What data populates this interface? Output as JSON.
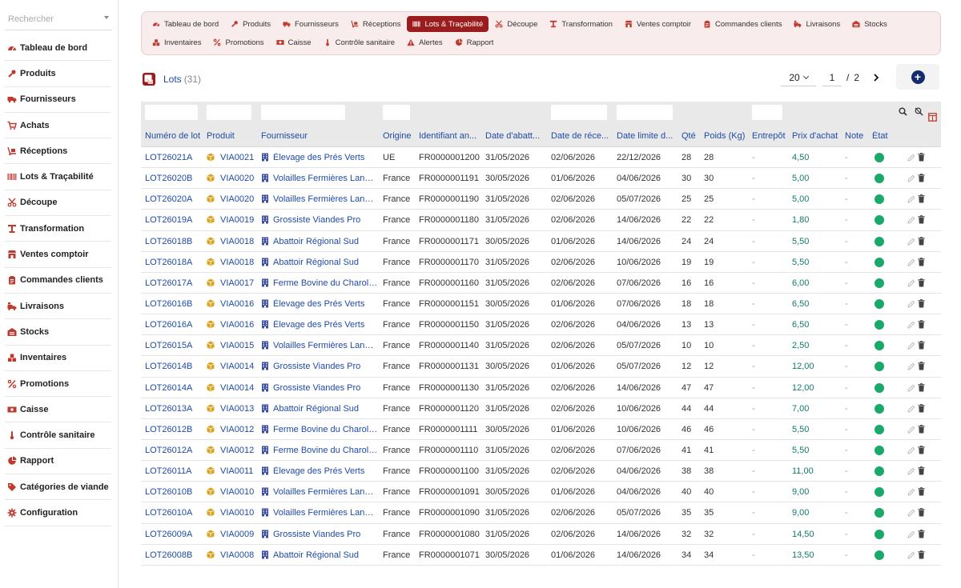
{
  "sidebar": {
    "search_placeholder": "Rechercher",
    "items": [
      {
        "label": "Tableau de bord",
        "icon": "dashboard-icon"
      },
      {
        "label": "Produits",
        "icon": "meat-icon"
      },
      {
        "label": "Fournisseurs",
        "icon": "truck-icon"
      },
      {
        "label": "Achats",
        "icon": "cart-icon"
      },
      {
        "label": "Réceptions",
        "icon": "dolly-icon"
      },
      {
        "label": "Lots & Traçabilité",
        "icon": "barcode-icon"
      },
      {
        "label": "Découpe",
        "icon": "scissors-icon"
      },
      {
        "label": "Transformation",
        "icon": "industry-icon"
      },
      {
        "label": "Ventes comptoir",
        "icon": "store-icon"
      },
      {
        "label": "Commandes clients",
        "icon": "clipboard-icon"
      },
      {
        "label": "Livraisons",
        "icon": "delivery-icon"
      },
      {
        "label": "Stocks",
        "icon": "warehouse-icon"
      },
      {
        "label": "Inventaires",
        "icon": "boxes-icon"
      },
      {
        "label": "Promotions",
        "icon": "percent-icon"
      },
      {
        "label": "Caisse",
        "icon": "money-icon"
      },
      {
        "label": "Contrôle sanitaire",
        "icon": "thermometer-icon"
      },
      {
        "label": "Rapport",
        "icon": "pie-chart-icon"
      },
      {
        "label": "Catégories de viande",
        "icon": "tags-icon"
      },
      {
        "label": "Configuration",
        "icon": "gear-icon"
      }
    ]
  },
  "topnav": {
    "items": [
      {
        "label": "Tableau de bord",
        "icon": "dashboard-icon",
        "active": false
      },
      {
        "label": "Produits",
        "icon": "meat-icon",
        "active": false
      },
      {
        "label": "Fournisseurs",
        "icon": "truck-icon",
        "active": false
      },
      {
        "label": "Réceptions",
        "icon": "dolly-icon",
        "active": false
      },
      {
        "label": "Lots & Traçabilité",
        "icon": "barcode-icon",
        "active": true
      },
      {
        "label": "Découpe",
        "icon": "scissors-icon",
        "active": false
      },
      {
        "label": "Transformation",
        "icon": "industry-icon",
        "active": false
      },
      {
        "label": "Ventes comptoir",
        "icon": "store-icon",
        "active": false
      },
      {
        "label": "Commandes clients",
        "icon": "clipboard-icon",
        "active": false
      },
      {
        "label": "Livraisons",
        "icon": "delivery-icon",
        "active": false
      },
      {
        "label": "Stocks",
        "icon": "warehouse-icon",
        "active": false
      },
      {
        "label": "Inventaires",
        "icon": "boxes-icon",
        "active": false
      },
      {
        "label": "Promotions",
        "icon": "percent-icon",
        "active": false
      },
      {
        "label": "Caisse",
        "icon": "money-icon",
        "active": false
      },
      {
        "label": "Contrôle sanitaire",
        "icon": "thermometer-icon",
        "active": false
      },
      {
        "label": "Alertes",
        "icon": "warning-icon",
        "active": false
      },
      {
        "label": "Rapport",
        "icon": "pie-chart-icon",
        "active": false
      }
    ]
  },
  "header": {
    "title": "Lots",
    "count": "(31)",
    "per_page": "20",
    "page_current": "1",
    "page_sep": "/",
    "page_total": "2"
  },
  "colors": {
    "accent": "#9b1c1c",
    "link": "#1f4aa8",
    "price": "#127a6d",
    "state_ok": "#1aa86b",
    "add_button": "#142c6e"
  },
  "table": {
    "headers": [
      "Numéro de lot",
      "Produit",
      "Fournisseur",
      "Origine",
      "Identifiant an...",
      "Date d'abatt...",
      "Date de réce...",
      "Date limite d...",
      "Qté",
      "Poids (Kg)",
      "Entrepôt",
      "Prix d'achat",
      "Note",
      "État"
    ],
    "rows": [
      [
        "LOT26021A",
        "VIA0021",
        "Élevage des Prés Verts",
        "UE",
        "FR0000001200",
        "31/05/2026",
        "02/06/2026",
        "22/12/2026",
        "28",
        "28",
        "-",
        "4,50",
        "-"
      ],
      [
        "LOT26020B",
        "VIA0020",
        "Volailles Fermières Landes",
        "France",
        "FR0000001191",
        "30/05/2026",
        "01/06/2026",
        "04/06/2026",
        "30",
        "30",
        "-",
        "5,00",
        "-"
      ],
      [
        "LOT26020A",
        "VIA0020",
        "Volailles Fermières Landes",
        "France",
        "FR0000001190",
        "31/05/2026",
        "02/06/2026",
        "05/07/2026",
        "25",
        "25",
        "-",
        "5,00",
        "-"
      ],
      [
        "LOT26019A",
        "VIA0019",
        "Grossiste Viandes Pro",
        "France",
        "FR0000001180",
        "31/05/2026",
        "02/06/2026",
        "14/06/2026",
        "22",
        "22",
        "-",
        "1,80",
        "-"
      ],
      [
        "LOT26018B",
        "VIA0018",
        "Abattoir Régional Sud",
        "France",
        "FR0000001171",
        "30/05/2026",
        "01/06/2026",
        "14/06/2026",
        "24",
        "24",
        "-",
        "5,50",
        "-"
      ],
      [
        "LOT26018A",
        "VIA0018",
        "Abattoir Régional Sud",
        "France",
        "FR0000001170",
        "31/05/2026",
        "02/06/2026",
        "10/06/2026",
        "19",
        "19",
        "-",
        "5,50",
        "-"
      ],
      [
        "LOT26017A",
        "VIA0017",
        "Ferme Bovine du Charolais",
        "France",
        "FR0000001160",
        "31/05/2026",
        "02/06/2026",
        "07/06/2026",
        "16",
        "16",
        "-",
        "6,00",
        "-"
      ],
      [
        "LOT26016B",
        "VIA0016",
        "Élevage des Prés Verts",
        "France",
        "FR0000001151",
        "30/05/2026",
        "01/06/2026",
        "07/06/2026",
        "18",
        "18",
        "-",
        "6,50",
        "-"
      ],
      [
        "LOT26016A",
        "VIA0016",
        "Élevage des Prés Verts",
        "France",
        "FR0000001150",
        "31/05/2026",
        "02/06/2026",
        "04/06/2026",
        "13",
        "13",
        "-",
        "6,50",
        "-"
      ],
      [
        "LOT26015A",
        "VIA0015",
        "Volailles Fermières Landes",
        "France",
        "FR0000001140",
        "31/05/2026",
        "02/06/2026",
        "05/07/2026",
        "10",
        "10",
        "-",
        "2,50",
        "-"
      ],
      [
        "LOT26014B",
        "VIA0014",
        "Grossiste Viandes Pro",
        "France",
        "FR0000001131",
        "30/05/2026",
        "01/06/2026",
        "05/07/2026",
        "12",
        "12",
        "-",
        "12,00",
        "-"
      ],
      [
        "LOT26014A",
        "VIA0014",
        "Grossiste Viandes Pro",
        "France",
        "FR0000001130",
        "31/05/2026",
        "02/06/2026",
        "14/06/2026",
        "47",
        "47",
        "-",
        "12,00",
        "-"
      ],
      [
        "LOT26013A",
        "VIA0013",
        "Abattoir Régional Sud",
        "France",
        "FR0000001120",
        "31/05/2026",
        "02/06/2026",
        "10/06/2026",
        "44",
        "44",
        "-",
        "7,00",
        "-"
      ],
      [
        "LOT26012B",
        "VIA0012",
        "Ferme Bovine du Charolais",
        "France",
        "FR0000001111",
        "30/05/2026",
        "01/06/2026",
        "10/06/2026",
        "46",
        "46",
        "-",
        "5,50",
        "-"
      ],
      [
        "LOT26012A",
        "VIA0012",
        "Ferme Bovine du Charolais",
        "France",
        "FR0000001110",
        "31/05/2026",
        "02/06/2026",
        "07/06/2026",
        "41",
        "41",
        "-",
        "5,50",
        "-"
      ],
      [
        "LOT26011A",
        "VIA0011",
        "Élevage des Prés Verts",
        "France",
        "FR0000001100",
        "31/05/2026",
        "02/06/2026",
        "04/06/2026",
        "38",
        "38",
        "-",
        "11,00",
        "-"
      ],
      [
        "LOT26010B",
        "VIA0010",
        "Volailles Fermières Landes",
        "France",
        "FR0000001091",
        "30/05/2026",
        "01/06/2026",
        "04/06/2026",
        "40",
        "40",
        "-",
        "9,00",
        "-"
      ],
      [
        "LOT26010A",
        "VIA0010",
        "Volailles Fermières Landes",
        "France",
        "FR0000001090",
        "31/05/2026",
        "02/06/2026",
        "05/07/2026",
        "35",
        "35",
        "-",
        "9,00",
        "-"
      ],
      [
        "LOT26009A",
        "VIA0009",
        "Grossiste Viandes Pro",
        "France",
        "FR0000001080",
        "31/05/2026",
        "02/06/2026",
        "14/06/2026",
        "32",
        "32",
        "-",
        "14,50",
        "-"
      ],
      [
        "LOT26008B",
        "VIA0008",
        "Abattoir Régional Sud",
        "France",
        "FR0000001071",
        "30/05/2026",
        "01/06/2026",
        "14/06/2026",
        "34",
        "34",
        "-",
        "13,50",
        "-"
      ]
    ]
  }
}
